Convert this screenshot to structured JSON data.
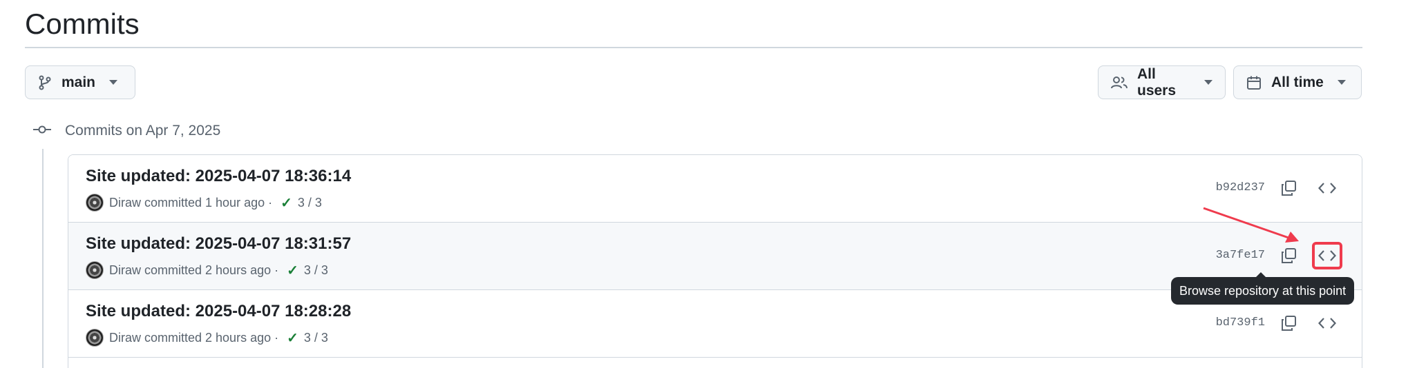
{
  "page": {
    "title": "Commits"
  },
  "filters": {
    "branch": {
      "label": "main",
      "icon": "git-branch-icon"
    },
    "users": {
      "label": "All users",
      "icon": "people-icon"
    },
    "time": {
      "label": "All time",
      "icon": "calendar-icon"
    }
  },
  "group": {
    "label": "Commits on Apr 7, 2025",
    "icon": "git-commit-icon"
  },
  "commits": [
    {
      "title": "Site updated: 2025-04-07 18:36:14",
      "meta": "Diraw committed 1 hour ago ·",
      "checks": "3 / 3",
      "sha": "b92d237"
    },
    {
      "title": "Site updated: 2025-04-07 18:31:57",
      "meta": "Diraw committed 2 hours ago ·",
      "checks": "3 / 3",
      "sha": "3a7fe17"
    },
    {
      "title": "Site updated: 2025-04-07 18:28:28",
      "meta": "Diraw committed 2 hours ago ·",
      "checks": "3 / 3",
      "sha": "bd739f1"
    }
  ],
  "tooltip": {
    "text": "Browse repository at this point"
  },
  "colors": {
    "highlight": "#ef3b4d",
    "check": "#1a7f37",
    "tooltip_bg": "#25292e"
  }
}
